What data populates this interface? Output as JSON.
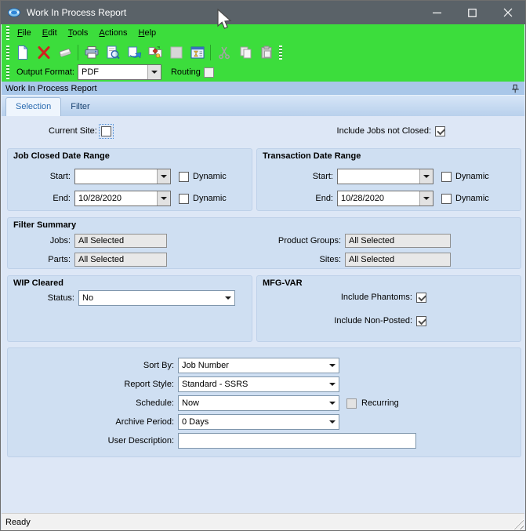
{
  "window": {
    "title": "Work In Process Report",
    "app_icon": "blue-disc-icon"
  },
  "menu": {
    "items": [
      "File",
      "Edit",
      "Tools",
      "Actions",
      "Help"
    ]
  },
  "toolbar": {
    "icons": [
      "new-report-icon",
      "delete-icon",
      "clear-icon",
      "print-icon",
      "print-preview-icon",
      "send-report-icon",
      "export-transfer-icon",
      "blank-disabled-icon",
      "schedule-icon",
      "cut-icon",
      "copy-icon",
      "paste-icon"
    ],
    "output_format_label": "Output Format:",
    "output_format_value": "PDF",
    "routing_label": "Routing"
  },
  "panel": {
    "header": "Work In Process Report",
    "pin_icon": "auto-hide-pin"
  },
  "tabs": [
    {
      "label": "Selection",
      "active": true
    },
    {
      "label": "Filter",
      "active": false
    }
  ],
  "selection": {
    "current_site": {
      "label": "Current Site:",
      "checked": false
    },
    "include_jobs_not_closed": {
      "label": "Include Jobs not Closed:",
      "checked": true
    },
    "job_closed": {
      "title": "Job Closed Date Range",
      "start_label": "Start:",
      "start_value": "",
      "end_label": "End:",
      "end_value": "10/28/2020",
      "dynamic_label": "Dynamic",
      "start_dynamic_checked": false,
      "end_dynamic_checked": false
    },
    "transaction": {
      "title": "Transaction Date Range",
      "start_label": "Start:",
      "start_value": "",
      "end_label": "End:",
      "end_value": "10/28/2020",
      "dynamic_label": "Dynamic",
      "start_dynamic_checked": false,
      "end_dynamic_checked": false
    },
    "filter_summary": {
      "title": "Filter Summary",
      "jobs_label": "Jobs:",
      "jobs_value": "All Selected",
      "parts_label": "Parts:",
      "parts_value": "All Selected",
      "product_groups_label": "Product Groups:",
      "product_groups_value": "All Selected",
      "sites_label": "Sites:",
      "sites_value": "All Selected"
    },
    "wip_cleared": {
      "title": "WIP Cleared",
      "status_label": "Status:",
      "status_value": "No"
    },
    "mfg_var": {
      "title": "MFG-VAR",
      "include_phantoms_label": "Include Phantoms:",
      "include_phantoms_checked": true,
      "include_non_posted_label": "Include Non-Posted:",
      "include_non_posted_checked": true
    },
    "options": {
      "sort_by_label": "Sort By:",
      "sort_by_value": "Job Number",
      "report_style_label": "Report Style:",
      "report_style_value": "Standard - SSRS",
      "schedule_label": "Schedule:",
      "schedule_value": "Now",
      "recurring_label": "Recurring",
      "recurring_checked": false,
      "recurring_enabled": false,
      "archive_period_label": "Archive Period:",
      "archive_period_value": "0 Days",
      "user_description_label": "User Description:",
      "user_description_value": "",
      "user_description_placeholder": ""
    }
  },
  "status_bar": {
    "text": "Ready"
  },
  "colors": {
    "titlebar": "#5a6268",
    "command_area": "#3cdd3c",
    "panel_header": "#a9c7e9",
    "page_background": "#dde7f6",
    "group_background": "#cfdff2",
    "active_tab_text": "#2a6bb0"
  }
}
